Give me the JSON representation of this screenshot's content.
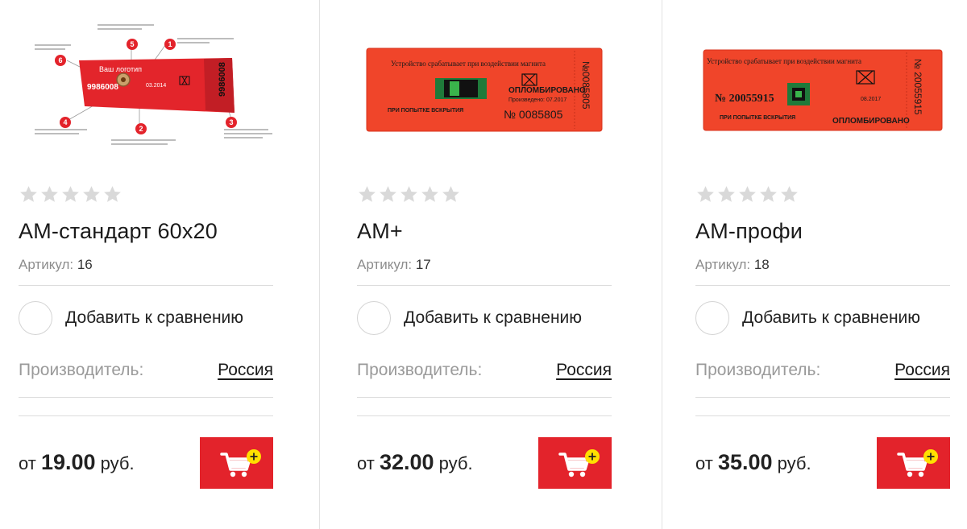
{
  "colors": {
    "accent": "#e3232b",
    "star_empty": "#d9d9d9",
    "divider": "#dcdcdc",
    "cart_badge": "#ffe000"
  },
  "products": [
    {
      "image_icon": "magnetic-seal-label-diagram",
      "image": {
        "label_main": "9986008",
        "label_side": "9986008",
        "label_logo": "Ваш логотип",
        "label_date": "03.2014",
        "callouts": [
          "1",
          "2",
          "3",
          "4",
          "5",
          "6"
        ]
      },
      "rating": 0,
      "title": "АМ-стандарт 60х20",
      "sku_label": "Артикул:",
      "sku": "16",
      "compare_label": "Добавить к сравнению",
      "maker_label": "Производитель:",
      "maker": "Россия",
      "price_prefix": "от",
      "price": "19.00",
      "currency": "руб."
    },
    {
      "image_icon": "magnetic-seal-label",
      "image": {
        "label_top": "Устройство срабатывает при воздействии магнита",
        "label_sealed": "ОПЛОМБИРОВАНО",
        "label_number": "№ 0085805",
        "label_side": "№0085805",
        "label_bottom": "ПРИ ПОПЫТКЕ ВСКРЫТИЯ",
        "label_date": "Произведено: 07.2017"
      },
      "rating": 0,
      "title": "АМ+",
      "sku_label": "Артикул:",
      "sku": "17",
      "compare_label": "Добавить к сравнению",
      "maker_label": "Производитель:",
      "maker": "Россия",
      "price_prefix": "от",
      "price": "32.00",
      "currency": "руб."
    },
    {
      "image_icon": "magnetic-seal-label",
      "image": {
        "label_top": "Устройство срабатывает при воздействии магнита",
        "label_sealed": "ОПЛОМБИРОВАНО",
        "label_number": "№ 20055915",
        "label_side": "№ 20055915",
        "label_bottom": "ПРИ ПОПЫТКЕ ВСКРЫТИЯ",
        "label_date": "08.2017"
      },
      "rating": 0,
      "title": "АМ-профи",
      "sku_label": "Артикул:",
      "sku": "18",
      "compare_label": "Добавить к сравнению",
      "maker_label": "Производитель:",
      "maker": "Россия",
      "price_prefix": "от",
      "price": "35.00",
      "currency": "руб."
    }
  ]
}
